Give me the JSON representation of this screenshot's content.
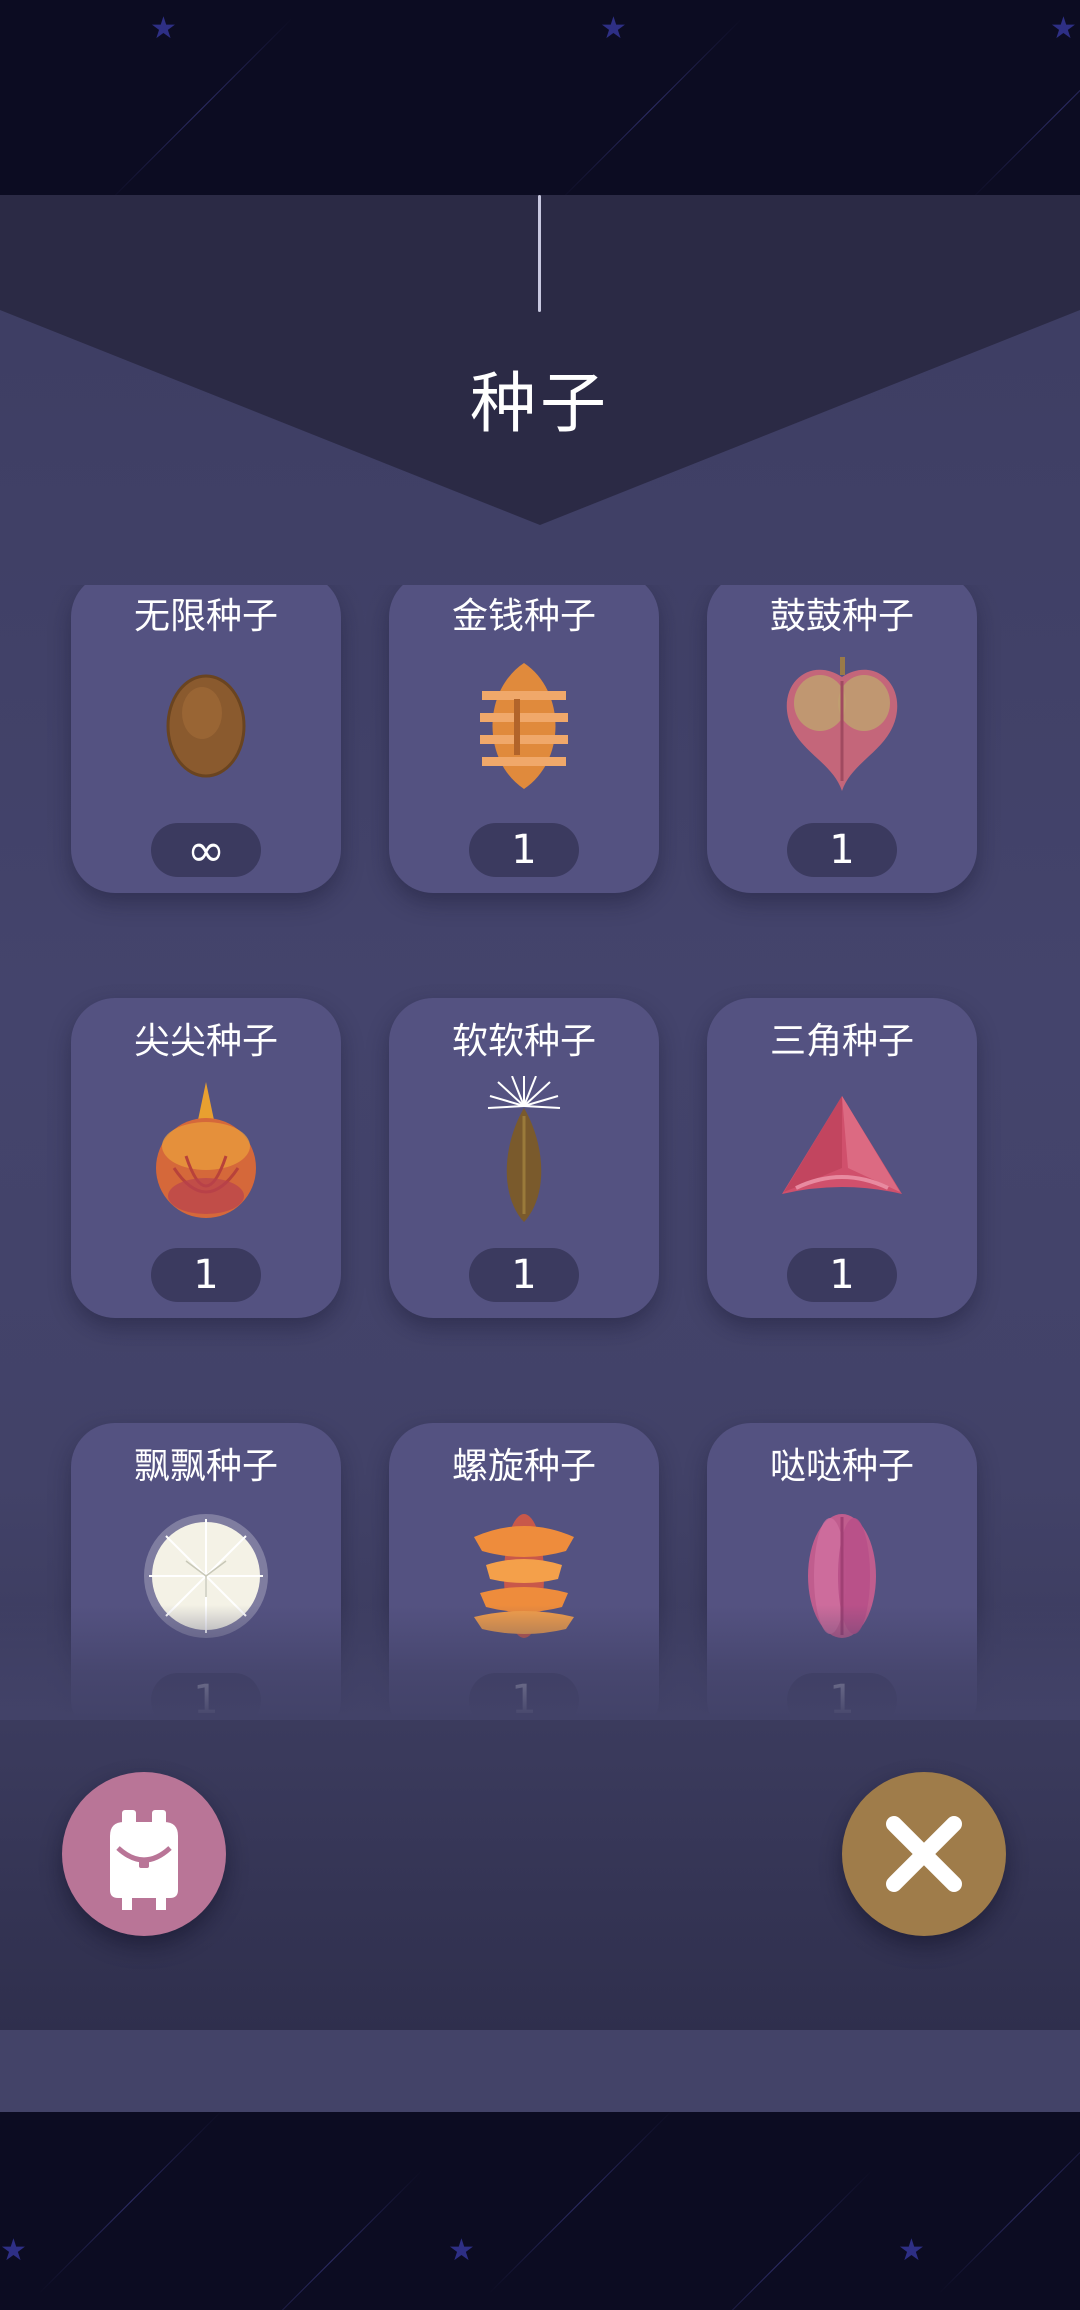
{
  "screen": {
    "title": "种子"
  },
  "seeds": [
    {
      "name": "无限种子",
      "count": "∞",
      "icon": "almond-seed-icon",
      "color": "#8a5a2e"
    },
    {
      "name": "金钱种子",
      "count": "1",
      "icon": "striped-orange-seed-icon",
      "color": "#e08a3c"
    },
    {
      "name": "鼓鼓种子",
      "count": "1",
      "icon": "heart-pod-seed-icon",
      "color": "#c4667a"
    },
    {
      "name": "尖尖种子",
      "count": "1",
      "icon": "pointed-round-seed-icon",
      "color": "#d5683a"
    },
    {
      "name": "软软种子",
      "count": "1",
      "icon": "fluffy-tip-seed-icon",
      "color": "#7a5a2c"
    },
    {
      "name": "三角种子",
      "count": "1",
      "icon": "triangle-seed-icon",
      "color": "#d0506c"
    },
    {
      "name": "飘飘种子",
      "count": "1",
      "icon": "dandelion-seed-icon",
      "color": "#f4f2e6"
    },
    {
      "name": "螺旋种子",
      "count": "1",
      "icon": "spiral-seed-icon",
      "color": "#ee8c3c"
    },
    {
      "name": "哒哒种子",
      "count": "1",
      "icon": "ribbed-pink-seed-icon",
      "color": "#c05d8e"
    }
  ],
  "buttons": {
    "backpack": {
      "icon": "backpack-icon",
      "color": "#b97597"
    },
    "close": {
      "icon": "close-icon",
      "color": "#9f7c4a"
    }
  }
}
